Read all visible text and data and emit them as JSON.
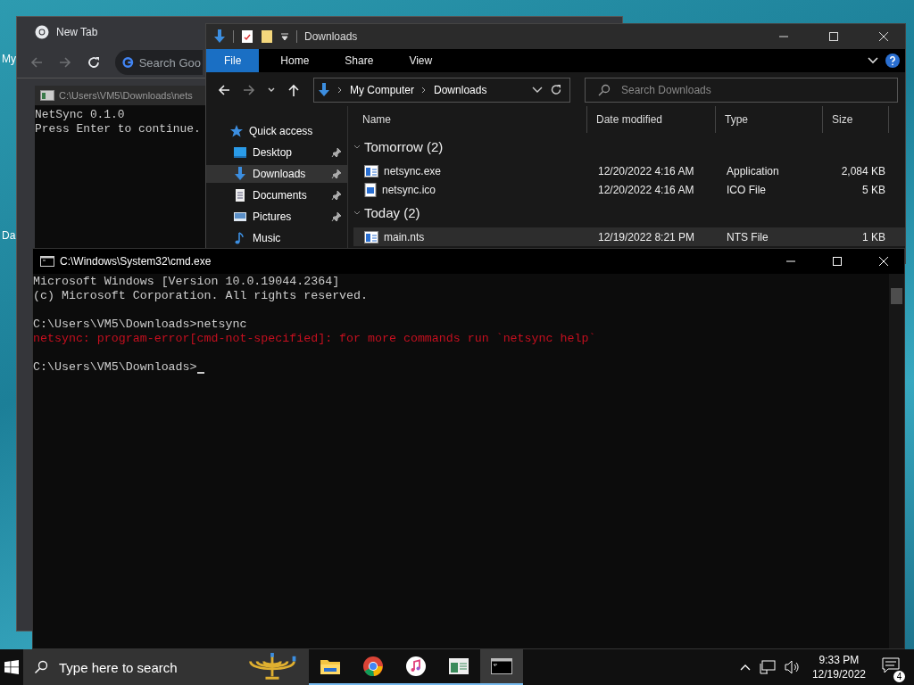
{
  "desktop": {
    "icons": [
      {
        "label": "My"
      },
      {
        "label": "Da"
      }
    ]
  },
  "browser": {
    "tab_title": "New Tab",
    "omnibox_placeholder": "Search Goo"
  },
  "console_back": {
    "title": "C:\\Users\\VM5\\Downloads\\nets",
    "lines": [
      "NetSync 0.1.0",
      "Press Enter to continue."
    ]
  },
  "explorer": {
    "title": "Downloads",
    "ribbon_tabs": [
      {
        "label": "File",
        "selected": true
      },
      {
        "label": "Home",
        "selected": false
      },
      {
        "label": "Share",
        "selected": false
      },
      {
        "label": "View",
        "selected": false
      }
    ],
    "breadcrumb": [
      "My Computer",
      "Downloads"
    ],
    "search": {
      "placeholder": "Search Downloads"
    },
    "nav_items": [
      {
        "label": "Quick access",
        "kind": "star",
        "pinned": false,
        "selected": false
      },
      {
        "label": "Desktop",
        "kind": "desktop",
        "pinned": true,
        "selected": false
      },
      {
        "label": "Downloads",
        "kind": "download",
        "pinned": true,
        "selected": true
      },
      {
        "label": "Documents",
        "kind": "document",
        "pinned": true,
        "selected": false
      },
      {
        "label": "Pictures",
        "kind": "pictures",
        "pinned": true,
        "selected": false
      },
      {
        "label": "Music",
        "kind": "music",
        "pinned": false,
        "selected": false
      }
    ],
    "columns": [
      "Name",
      "Date modified",
      "Type",
      "Size"
    ],
    "groups": [
      {
        "label": "Tomorrow (2)",
        "files": [
          {
            "name": "netsync.exe",
            "kind": "app",
            "date": "12/20/2022 4:16 AM",
            "type": "Application",
            "size": "2,084 KB",
            "selected": false
          },
          {
            "name": "netsync.ico",
            "kind": "image",
            "date": "12/20/2022 4:16 AM",
            "type": "ICO File",
            "size": "5 KB",
            "selected": false
          }
        ]
      },
      {
        "label": "Today (2)",
        "files": [
          {
            "name": "main.nts",
            "kind": "app",
            "date": "12/19/2022 8:21 PM",
            "type": "NTS File",
            "size": "1 KB",
            "selected": true
          }
        ]
      }
    ]
  },
  "cmd": {
    "title": "C:\\Windows\\System32\\cmd.exe",
    "lines": [
      {
        "text": "Microsoft Windows [Version 10.0.19044.2364]",
        "kind": "output"
      },
      {
        "text": "(c) Microsoft Corporation. All rights reserved.",
        "kind": "output"
      },
      {
        "kind": "blank"
      },
      {
        "text": "C:\\Users\\VM5\\Downloads>netsync",
        "kind": "output"
      },
      {
        "text": "netsync: program-error[cmd-not-specified]: for more commands run `netsync help`",
        "kind": "error"
      },
      {
        "kind": "blank"
      },
      {
        "text": "C:\\Users\\VM5\\Downloads>",
        "kind": "prompt"
      }
    ]
  },
  "taskbar": {
    "search_placeholder": "Type here to search",
    "apps": [
      {
        "kind": "folder",
        "selected": false
      },
      {
        "kind": "browser",
        "selected": false
      },
      {
        "kind": "music",
        "selected": false
      },
      {
        "kind": "window",
        "selected": false
      },
      {
        "kind": "terminal",
        "selected": true
      }
    ],
    "time": "9:33 PM",
    "date": "12/19/2022",
    "notification_count": "4"
  }
}
